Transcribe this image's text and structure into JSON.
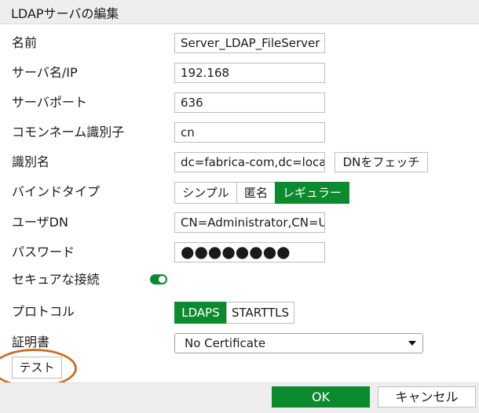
{
  "dialog": {
    "title": "LDAPサーバの編集"
  },
  "labels": {
    "name": "名前",
    "server": "サーバ名/IP",
    "port": "サーバポート",
    "cn": "コモンネーム識別子",
    "dn": "識別名",
    "bind_type": "バインドタイプ",
    "user_dn": "ユーザDN",
    "password": "パスワード",
    "secure": "セキュアな接続",
    "protocol": "プロトコル",
    "certificate": "証明書"
  },
  "fields": {
    "name": "Server_LDAP_FileServer",
    "server": "192.168",
    "port": "636",
    "cn": "cn",
    "dn": "dc=fabrica-com,dc=local",
    "user_dn": "CN=Administrator,CN=Us",
    "password": "●●●●●●●●"
  },
  "buttons": {
    "fetch_dn": "DNをフェッチ",
    "test": "テスト",
    "ok": "OK",
    "cancel": "キャンセル"
  },
  "bind_options": [
    "シンプル",
    "匿名",
    "レギュラー"
  ],
  "bind_selected": "レギュラー",
  "protocol_options": [
    "LDAPS",
    "STARTTLS"
  ],
  "protocol_selected": "LDAPS",
  "secure_connection_enabled": true,
  "certificate": {
    "selected": "No Certificate"
  },
  "colors": {
    "accent": "#0b8a2e",
    "highlight_circle": "#c8722a"
  }
}
